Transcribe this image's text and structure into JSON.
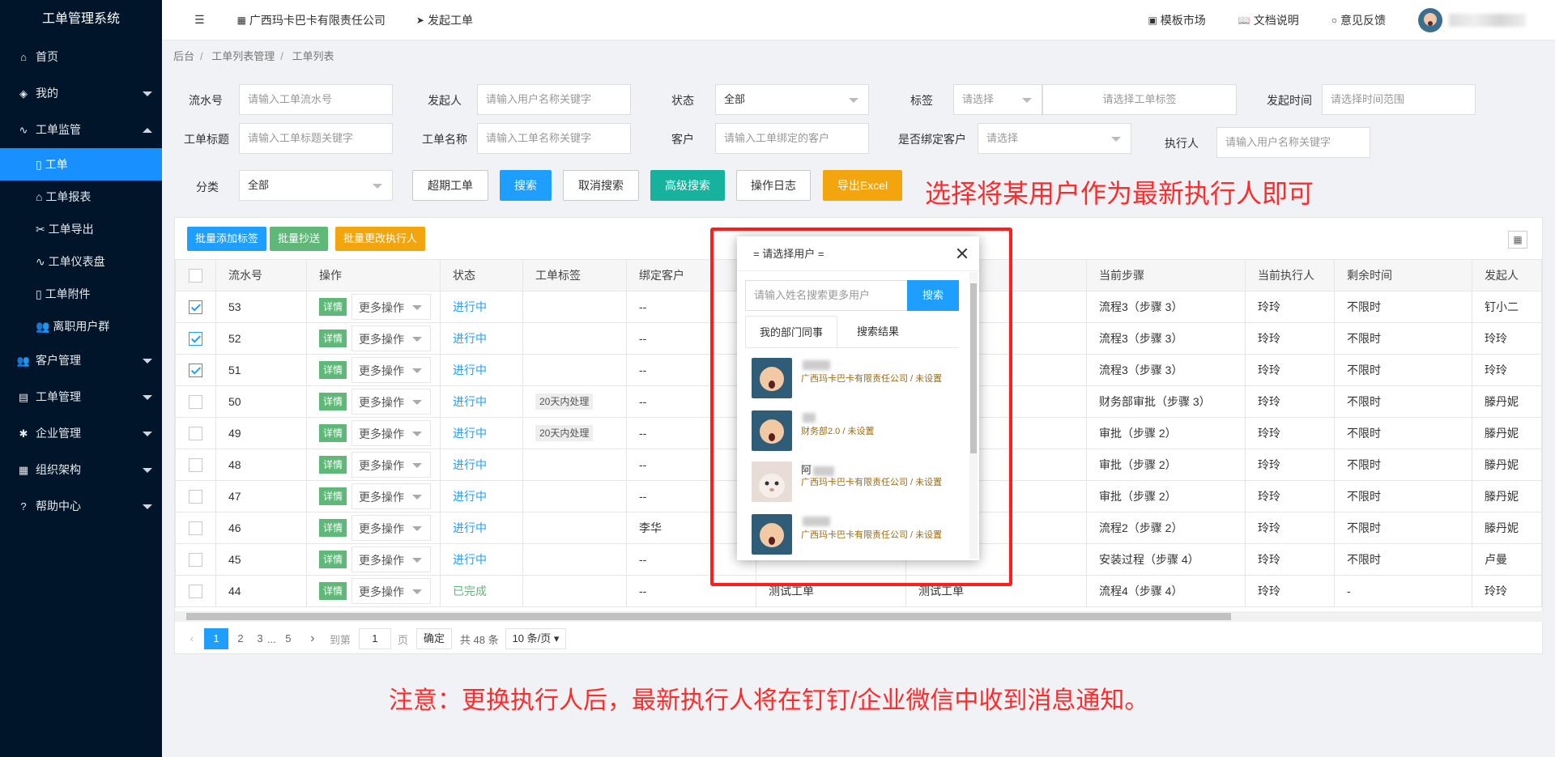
{
  "app": {
    "title": "工单管理系统"
  },
  "sidebar": {
    "items": [
      {
        "label": "首页",
        "icon": "home-icon"
      },
      {
        "label": "我的",
        "icon": "layers-icon"
      },
      {
        "label": "工单监管",
        "icon": "pulse-icon"
      },
      {
        "label": "客户管理",
        "icon": "users-icon"
      },
      {
        "label": "工单管理",
        "icon": "clipboard-icon"
      },
      {
        "label": "企业管理",
        "icon": "gear-icon"
      },
      {
        "label": "组织架构",
        "icon": "calendar-icon"
      },
      {
        "label": "帮助中心",
        "icon": "question-icon"
      }
    ],
    "sub_items": [
      {
        "label": "工单",
        "icon": "file-icon"
      },
      {
        "label": "工单报表",
        "icon": "home-icon"
      },
      {
        "label": "工单导出",
        "icon": "tools-icon"
      },
      {
        "label": "工单仪表盘",
        "icon": "pulse-icon"
      },
      {
        "label": "工单附件",
        "icon": "file-icon"
      },
      {
        "label": "离职用户群",
        "icon": "users-icon"
      }
    ]
  },
  "topbar": {
    "company": "广西玛卡巴卡有限责任公司",
    "create": "发起工单",
    "market": "模板市场",
    "docs": "文档说明",
    "feedback": "意见反馈"
  },
  "breadcrumb": [
    "后台",
    "工单列表管理",
    "工单列表"
  ],
  "filters": {
    "serial": {
      "label": "流水号",
      "placeholder": "请输入工单流水号"
    },
    "initiator": {
      "label": "发起人",
      "placeholder": "请输入用户名称关键字"
    },
    "status": {
      "label": "状态",
      "value": "全部"
    },
    "tag": {
      "label": "标签",
      "value": "请选择",
      "placeholder": "请选择工单标签"
    },
    "created": {
      "label": "发起时间",
      "placeholder": "请选择时间范围"
    },
    "title": {
      "label": "工单标题",
      "placeholder": "请输入工单标题关键字"
    },
    "name": {
      "label": "工单名称",
      "placeholder": "请输入工单名称关键字"
    },
    "customer": {
      "label": "客户",
      "placeholder": "请输入工单绑定的客户"
    },
    "bound": {
      "label": "是否绑定客户",
      "value": "请选择"
    },
    "executor": {
      "label": "执行人",
      "placeholder": "请输入用户名称关键字"
    },
    "category": {
      "label": "分类",
      "value": "全部"
    }
  },
  "actions": {
    "overdue": "超期工单",
    "search": "搜索",
    "cancel": "取消搜索",
    "advanced": "高级搜索",
    "log": "操作日志",
    "export": "导出Excel"
  },
  "annotations": {
    "top": "选择将某用户作为最新执行人即可",
    "bottom": "注意：更换执行人后，最新执行人将在钉钉/企业微信中收到消息通知。"
  },
  "batch": {
    "add_tag": "批量添加标签",
    "cc": "批量抄送",
    "change_exec": "批量更改执行人"
  },
  "table": {
    "columns": [
      "流水号",
      "操作",
      "状态",
      "工单标签",
      "绑定客户",
      "",
      "",
      "当前步骤",
      "当前执行人",
      "剩余时间",
      "发起人"
    ],
    "detail_label": "详情",
    "more_label": "更多操作",
    "rows": [
      {
        "checked": true,
        "id": "53",
        "status": "进行中",
        "tag": "",
        "customer": "--",
        "c6": "",
        "c7": "",
        "step": "流程3（步骤 3）",
        "exec": "玲玲",
        "remain": "不限时",
        "initiator": "钉小二"
      },
      {
        "checked": true,
        "id": "52",
        "status": "进行中",
        "tag": "",
        "customer": "--",
        "c6": "",
        "c7": "",
        "step": "流程3（步骤 3）",
        "exec": "玲玲",
        "remain": "不限时",
        "initiator": "玲玲"
      },
      {
        "checked": true,
        "id": "51",
        "status": "进行中",
        "tag": "",
        "customer": "--",
        "c6": "",
        "c7": "",
        "step": "流程3（步骤 3）",
        "exec": "玲玲",
        "remain": "不限时",
        "initiator": "玲玲"
      },
      {
        "checked": false,
        "id": "50",
        "status": "进行中",
        "tag": "20天内处理",
        "customer": "--",
        "c6": "",
        "c7": "",
        "step": "财务部审批（步骤 3）",
        "exec": "玲玲",
        "remain": "不限时",
        "initiator": "滕丹妮"
      },
      {
        "checked": false,
        "id": "49",
        "status": "进行中",
        "tag": "20天内处理",
        "customer": "--",
        "c6": "",
        "c7": "",
        "step": "审批（步骤 2）",
        "exec": "玲玲",
        "remain": "不限时",
        "initiator": "滕丹妮"
      },
      {
        "checked": false,
        "id": "48",
        "status": "进行中",
        "tag": "",
        "customer": "--",
        "c6": "",
        "c7": "",
        "step": "审批（步骤 2）",
        "exec": "玲玲",
        "remain": "不限时",
        "initiator": "滕丹妮"
      },
      {
        "checked": false,
        "id": "47",
        "status": "进行中",
        "tag": "",
        "customer": "--",
        "c6": "",
        "c7": "",
        "step": "审批（步骤 2）",
        "exec": "玲玲",
        "remain": "不限时",
        "initiator": "滕丹妮"
      },
      {
        "checked": false,
        "id": "46",
        "status": "进行中",
        "tag": "",
        "customer": "李华",
        "c6": "",
        "c7": "",
        "step": "流程2（步骤 2）",
        "exec": "玲玲",
        "remain": "不限时",
        "initiator": "滕丹妮"
      },
      {
        "checked": false,
        "id": "45",
        "status": "进行中",
        "tag": "",
        "customer": "--",
        "c6": "",
        "c7": "",
        "step": "安装过程（步骤 4）",
        "exec": "玲玲",
        "remain": "不限时",
        "initiator": "卢曼"
      },
      {
        "checked": false,
        "id": "44",
        "status": "已完成",
        "tag": "",
        "customer": "--",
        "c6": "测试工单",
        "c7": "测试工单",
        "step": "流程4（步骤 4）",
        "exec": "玲玲",
        "remain": "-",
        "initiator": "玲玲"
      }
    ]
  },
  "pagination": {
    "pages": [
      "1",
      "2",
      "3",
      "...",
      "5"
    ],
    "goto_label": "到第",
    "goto_value": "1",
    "page_unit": "页",
    "confirm": "确定",
    "total": "共 48 条",
    "per_page": "10 条/页"
  },
  "modal": {
    "title": "= 请选择用户 =",
    "search_placeholder": "请输入姓名搜索更多用户",
    "search_btn": "搜索",
    "tabs": [
      "我的部门同事",
      "搜索结果"
    ],
    "users": [
      {
        "name": "",
        "dept": "广西玛卡巴卡有限责任公司 / 未设置"
      },
      {
        "name": "",
        "dept": "财务部2.0 / 未设置"
      },
      {
        "name": "阿",
        "dept": "广西玛卡巴卡有限责任公司 / 未设置"
      },
      {
        "name": "",
        "dept": "广西玛卡巴卡有限责任公司 / 未设置"
      }
    ]
  }
}
